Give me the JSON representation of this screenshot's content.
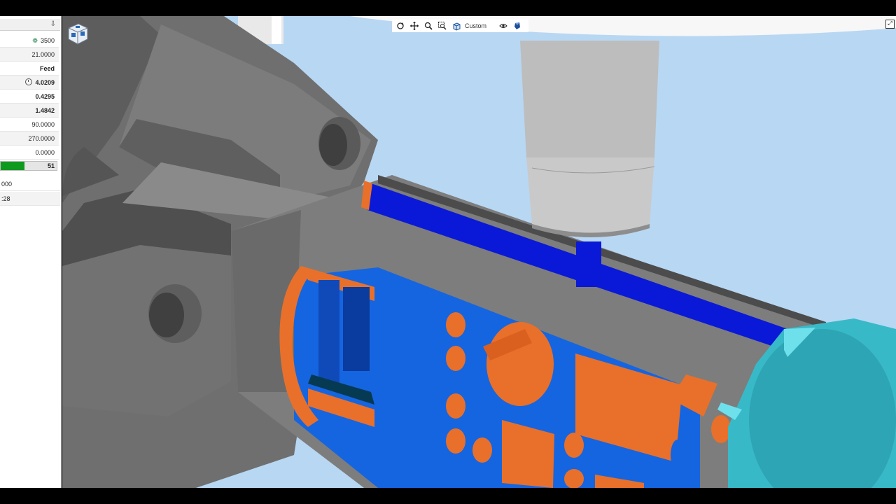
{
  "status_panel": {
    "pin_glyph": "⇩",
    "rows": [
      {
        "value": "3500",
        "icon": "spindle-icon"
      },
      {
        "value": "21.0000"
      },
      {
        "value": "Feed"
      },
      {
        "value": "4.0209",
        "icon": "clock-icon"
      },
      {
        "value": "0.4295"
      },
      {
        "value": "1.4842"
      },
      {
        "value": "90.0000"
      },
      {
        "value": "270.0000"
      },
      {
        "value": "0.0000"
      }
    ],
    "progress": {
      "percent": 43,
      "value": "51"
    },
    "extra_rows": [
      "000",
      ":28"
    ]
  },
  "toolbar": {
    "custom_label": "Custom",
    "icons": [
      "rotate-icon",
      "pan-icon",
      "zoom-icon",
      "zoom-window-icon",
      "view-cube-icon",
      "eye-icon",
      "shading-icon"
    ]
  },
  "viewport": {
    "background_color": "#b8d7f3",
    "colors": {
      "chuck_gray": "#7b7b7b",
      "part_orange": "#e8702a",
      "part_blue": "#1565e0",
      "coolant_blue": "#0a19d8",
      "tailstock_cyan": "#38b9c8",
      "tool_gray": "#bdbdbd"
    }
  }
}
